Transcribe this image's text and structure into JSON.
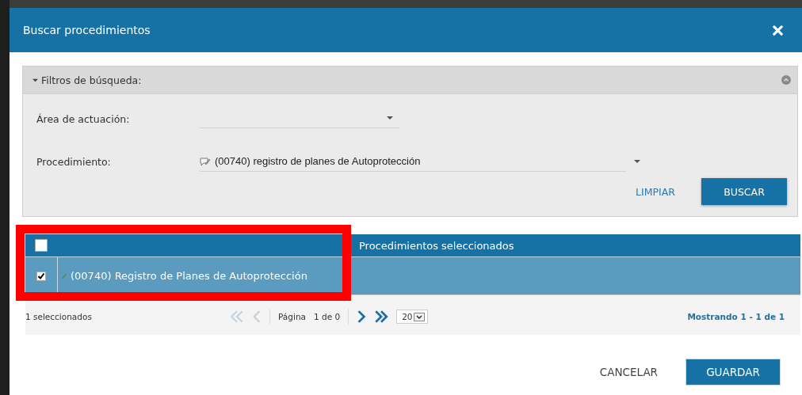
{
  "dialog": {
    "title": "Buscar procedimientos"
  },
  "filters": {
    "title": "Filtros de búsqueda:",
    "expanded": true,
    "fields": [
      {
        "label": "Área de actuación:",
        "kind": "select"
      },
      {
        "label": "Procedimiento:",
        "value": "(00740) registro de planes de Autoprotección",
        "kind": "select-icon"
      }
    ],
    "actions": [
      {
        "label": "LIMPIAR",
        "kind": "link"
      },
      {
        "label": "BUSCAR",
        "kind": "primary"
      }
    ]
  },
  "table": {
    "header_checked": false,
    "column": "Procedimientos seleccionados",
    "rows": [
      {
        "checked": true,
        "text": "(00740) Registro de Planes de Autoprotección"
      }
    ]
  },
  "pager": {
    "selected_count": "1 seleccionados",
    "page_label": "Página",
    "page_of": "1 de 0",
    "page_size": "20",
    "summary": "Mostrando 1 - 1 de 1"
  },
  "highlight": {
    "color": "#ff0000"
  },
  "buttons": [
    {
      "label": "CANCELAR",
      "kind": "link"
    },
    {
      "label": "GUARDAR",
      "kind": "primary"
    }
  ]
}
